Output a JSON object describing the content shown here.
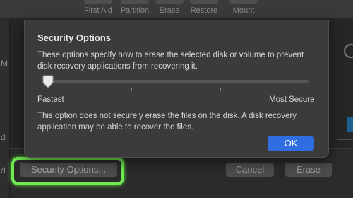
{
  "toolbar": {
    "first_aid": "First Aid",
    "partition": "Partition",
    "erase": "Erase",
    "restore": "Restore",
    "mount": "Mount"
  },
  "background": {
    "sidebar_chars": [
      "M",
      "d",
      "d"
    ],
    "right_char": "l",
    "security_options_button": "Security Options...",
    "cancel_button": "Cancel",
    "erase_button": "Erase"
  },
  "dialog": {
    "title": "Security Options",
    "description": "These options specify how to erase the selected disk or volume to prevent disk recovery applications from recovering it.",
    "slider": {
      "min_label": "Fastest",
      "max_label": "Most Secure",
      "positions": 4,
      "value": 0
    },
    "info": "This option does not securely erase the files on the disk. A disk recovery application may be able to recover the files.",
    "ok_button": "OK"
  },
  "colors": {
    "accent": "#2f6ee0",
    "highlight": "#6fea4f"
  }
}
